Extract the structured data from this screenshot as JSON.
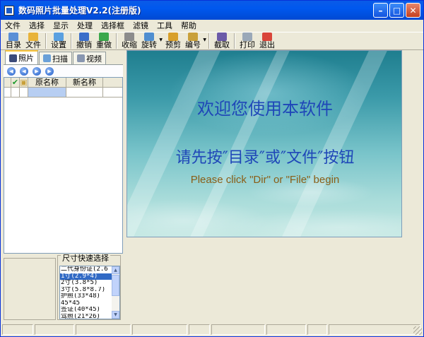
{
  "window": {
    "title": "数码照片批量处理V2.2(注册版)"
  },
  "menu": [
    "文件",
    "选择",
    "显示",
    "处理",
    "选择框",
    "滤镜",
    "工具",
    "帮助"
  ],
  "toolbar": [
    {
      "label": "目录",
      "icon": "folder-icon",
      "color": "#5A8FD6"
    },
    {
      "label": "文件",
      "icon": "file-icon",
      "color": "#E8B33A"
    },
    {
      "label": "设置",
      "icon": "settings-icon",
      "color": "#5AA0E0"
    },
    {
      "label": "撤销",
      "icon": "undo-icon",
      "color": "#3B6EC9"
    },
    {
      "label": "重做",
      "icon": "redo-icon",
      "color": "#3BA84B"
    },
    {
      "label": "收缩",
      "icon": "shrink-icon",
      "color": "#8C8C8C"
    },
    {
      "label": "旋转",
      "icon": "rotate-icon",
      "color": "#4F8ED0"
    },
    {
      "label": "预剪",
      "icon": "crop-icon",
      "color": "#D8A02C"
    },
    {
      "label": "编号",
      "icon": "number-icon",
      "color": "#C9A03A"
    },
    {
      "label": "截取",
      "icon": "capture-icon",
      "color": "#6B5AA8"
    },
    {
      "label": "打印",
      "icon": "print-icon",
      "color": "#9AA8B8"
    },
    {
      "label": "退出",
      "icon": "exit-icon",
      "color": "#D9453A"
    }
  ],
  "tabs": [
    {
      "label": "照片",
      "icon": "photo-icon",
      "color": "#3B4A7A"
    },
    {
      "label": "扫描",
      "icon": "scan-icon",
      "color": "#6AA0D8"
    },
    {
      "label": "视频",
      "icon": "video-icon",
      "color": "#8896B0"
    }
  ],
  "file_table": {
    "columns": [
      "原名称",
      "新名称"
    ]
  },
  "size_chooser": {
    "caption": "尺寸快速选择",
    "items": [
      "二代身份证(2.6",
      "1寸(2.9*4)",
      "2寸(3.8*5)",
      "3寸(5.8*8.7)",
      "护照(33*48)",
      "45*45",
      "签证(40*45)",
      "驾照(21*26)"
    ],
    "selected": 1
  },
  "canvas": {
    "line1": "欢迎您使用本软件",
    "line2": "请先按″目录″或″文件″按钮",
    "line3": "Please click \"Dir\" or \"File\" begin"
  }
}
